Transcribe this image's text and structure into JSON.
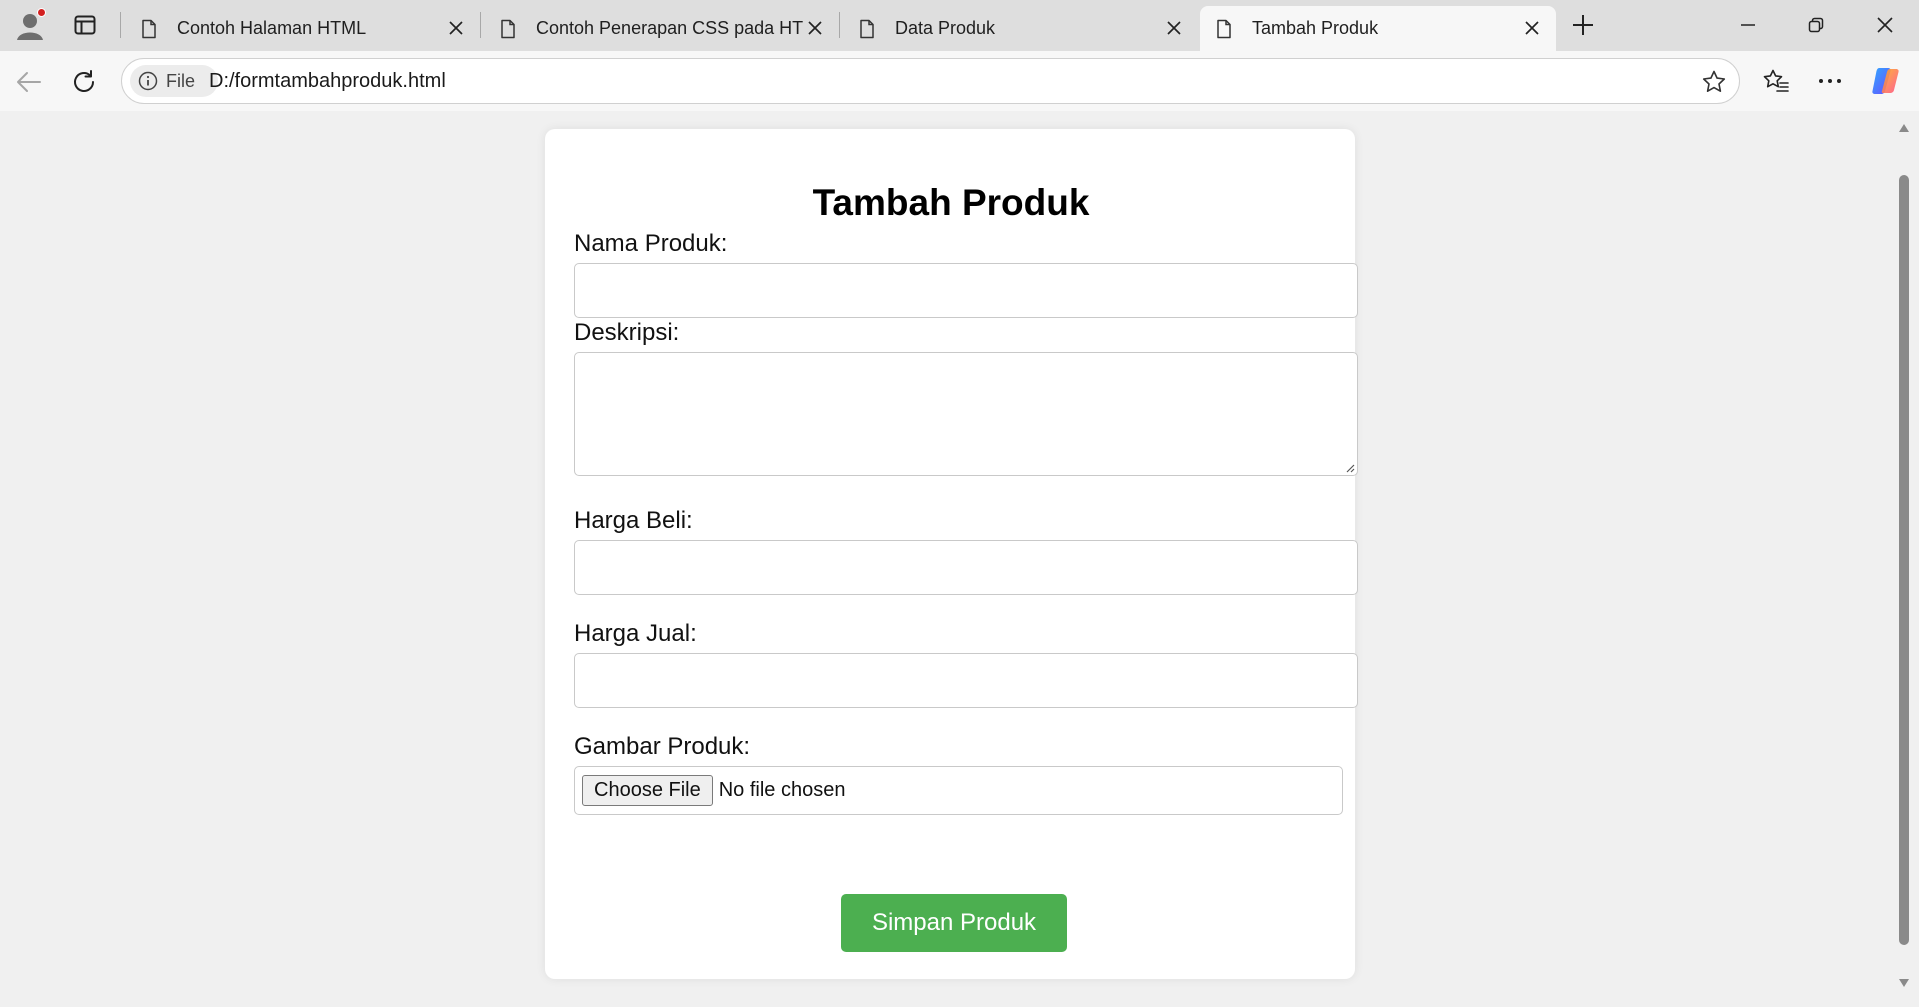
{
  "browser": {
    "tabs": [
      {
        "title": "Contoh Halaman HTML",
        "active": false
      },
      {
        "title": "Contoh Penerapan CSS pada HTML",
        "active": false
      },
      {
        "title": "Data Produk",
        "active": false
      },
      {
        "title": "Tambah Produk",
        "active": true
      }
    ],
    "site_chip_label": "File",
    "url": "D:/formtambahproduk.html"
  },
  "form": {
    "heading": "Tambah Produk",
    "nama_label": "Nama Produk:",
    "deskripsi_label": "Deskripsi:",
    "harga_beli_label": "Harga Beli:",
    "harga_jual_label": "Harga Jual:",
    "gambar_label": "Gambar Produk:",
    "choose_file_label": "Choose File",
    "file_status": "No file chosen",
    "submit_label": "Simpan Produk"
  },
  "colors": {
    "submit_button": "#4caf50",
    "page_background": "#f0f0f0",
    "tab_strip": "#dedede"
  },
  "icons": [
    "profile-icon",
    "tab-actions-icon",
    "document-icon",
    "close-icon",
    "plus-icon",
    "minimize-icon",
    "restore-icon",
    "window-close-icon",
    "back-icon",
    "refresh-icon",
    "info-icon",
    "star-icon",
    "favorites-icon",
    "more-icon",
    "copilot-icon"
  ]
}
